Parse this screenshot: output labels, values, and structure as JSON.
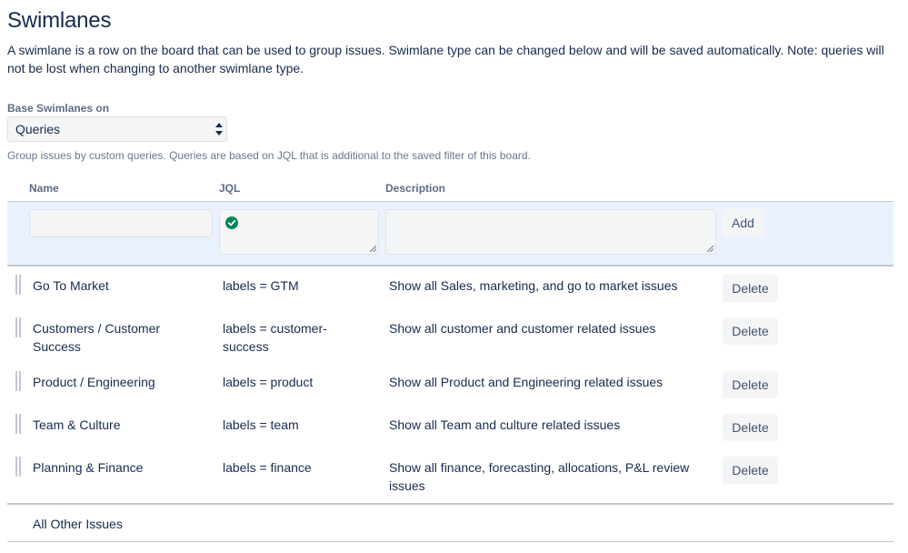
{
  "page": {
    "title": "Swimlanes",
    "intro": "A swimlane is a row on the board that can be used to group issues. Swimlane type can be changed below and will be saved automatically. Note: queries will not be lost when changing to another swimlane type."
  },
  "base": {
    "label": "Base Swimlanes on",
    "selected": "Queries",
    "help": "Group issues by custom queries. Queries are based on JQL that is additional to the saved filter of this board."
  },
  "table": {
    "headers": {
      "name": "Name",
      "jql": "JQL",
      "description": "Description"
    },
    "add_row": {
      "name_value": "",
      "jql_value": "",
      "description_value": "",
      "add_label": "Add",
      "jql_valid_color": "#00875a"
    },
    "rows": [
      {
        "name": "Go To Market",
        "jql": "labels = GTM",
        "description": "Show all Sales, marketing, and go to market issues",
        "delete_label": "Delete"
      },
      {
        "name": "Customers / Customer Success",
        "jql": "labels = customer-success",
        "description": "Show all customer and customer related issues",
        "delete_label": "Delete"
      },
      {
        "name": "Product / Engineering",
        "jql": "labels = product",
        "description": "Show all Product and Engineering related issues",
        "delete_label": "Delete"
      },
      {
        "name": "Team & Culture",
        "jql": "labels = team",
        "description": "Show all Team and culture related issues",
        "delete_label": "Delete"
      },
      {
        "name": "Planning & Finance",
        "jql": "labels = finance",
        "description": "Show all finance, forecasting, allocations, P&L review issues",
        "delete_label": "Delete"
      }
    ],
    "other": "All Other Issues"
  }
}
